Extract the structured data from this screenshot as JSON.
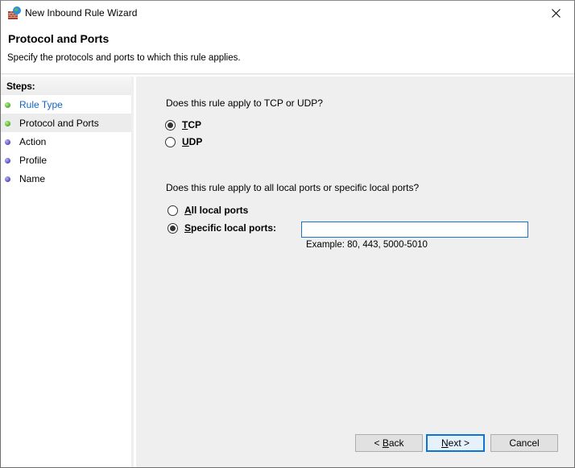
{
  "window": {
    "title": "New Inbound Rule Wizard",
    "close_label": "Close"
  },
  "header": {
    "title": "Protocol and Ports",
    "subtitle": "Specify the protocols and ports to which this rule applies."
  },
  "steps": {
    "heading": "Steps:",
    "items": [
      {
        "label": "Rule Type",
        "status": "done",
        "link": true,
        "active": false
      },
      {
        "label": "Protocol and Ports",
        "status": "done",
        "link": false,
        "active": true
      },
      {
        "label": "Action",
        "status": "pending",
        "link": false,
        "active": false
      },
      {
        "label": "Profile",
        "status": "pending",
        "link": false,
        "active": false
      },
      {
        "label": "Name",
        "status": "pending",
        "link": false,
        "active": false
      }
    ]
  },
  "protocol": {
    "question": "Does this rule apply to TCP or UDP?",
    "options": [
      {
        "mnemonic": "T",
        "rest": "CP",
        "checked": true
      },
      {
        "mnemonic": "U",
        "rest": "DP",
        "checked": false
      }
    ]
  },
  "ports": {
    "question": "Does this rule apply to all local ports or specific local ports?",
    "options": [
      {
        "mnemonic": "A",
        "rest": "ll local ports",
        "checked": false
      },
      {
        "mnemonic": "S",
        "rest": "pecific local ports:",
        "checked": true
      }
    ],
    "input_value": "",
    "example": "Example: 80, 443, 5000-5010"
  },
  "buttons": {
    "back_prefix": "< ",
    "back_mnemonic": "B",
    "back_rest": "ack",
    "next_mnemonic": "N",
    "next_rest": "ext >",
    "cancel": "Cancel"
  },
  "colors": {
    "link": "#1565c0",
    "focus_border": "#0f74d1",
    "step_done": "#43b02a",
    "step_pending": "#5347c4"
  }
}
